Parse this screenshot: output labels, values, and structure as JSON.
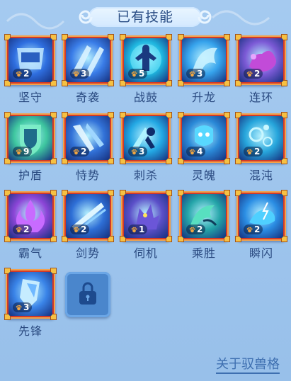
{
  "header": {
    "title": "已有技能"
  },
  "skills": [
    {
      "name": "坚守",
      "level": "2",
      "icon": "shield-armor-icon",
      "tint": "#2f6fe0"
    },
    {
      "name": "奇袭",
      "level": "3",
      "icon": "claw-strike-icon",
      "tint": "#3a7de8"
    },
    {
      "name": "战鼓",
      "level": "5",
      "icon": "warrior-glow-icon",
      "tint": "#1fb7e0"
    },
    {
      "name": "升龙",
      "level": "3",
      "icon": "dragon-ice-icon",
      "tint": "#36a3ec"
    },
    {
      "name": "连环",
      "level": "2",
      "icon": "purple-paw-icon",
      "tint": "#7c5ad6"
    },
    {
      "name": "护盾",
      "level": "9",
      "icon": "green-shield-icon",
      "tint": "#3fc7a0"
    },
    {
      "name": "恃势",
      "level": "2",
      "icon": "wing-armor-icon",
      "tint": "#3272d8"
    },
    {
      "name": "刺杀",
      "level": "3",
      "icon": "assassin-dash-icon",
      "tint": "#23a8e4"
    },
    {
      "name": "灵魄",
      "level": "4",
      "icon": "spirit-beast-icon",
      "tint": "#2b8ad8"
    },
    {
      "name": "混沌",
      "level": "2",
      "icon": "bubbles-icon",
      "tint": "#27a6dc"
    },
    {
      "name": "霸气",
      "level": "2",
      "icon": "purple-flame-icon",
      "tint": "#8d46d8"
    },
    {
      "name": "剑势",
      "level": "2",
      "icon": "sword-slash-icon",
      "tint": "#2e6fd6"
    },
    {
      "name": "伺机",
      "level": "1",
      "icon": "shadow-fox-icon",
      "tint": "#5b4fc8"
    },
    {
      "name": "乘胜",
      "level": "2",
      "icon": "beast-tail-icon",
      "tint": "#24a4a8"
    },
    {
      "name": "瞬闪",
      "level": "2",
      "icon": "lightning-beast-icon",
      "tint": "#2b8ee4"
    },
    {
      "name": "先锋",
      "level": "3",
      "icon": "crystal-icon",
      "tint": "#3a84e8"
    }
  ],
  "locked_slot": {
    "icon": "lock-icon"
  },
  "footer": {
    "link_label": "关于驭兽格"
  },
  "colors": {
    "frame": "#d23a28",
    "frame_trim": "#f4a24a",
    "name_text": "#2a4a80",
    "link": "#3e6fb0"
  }
}
